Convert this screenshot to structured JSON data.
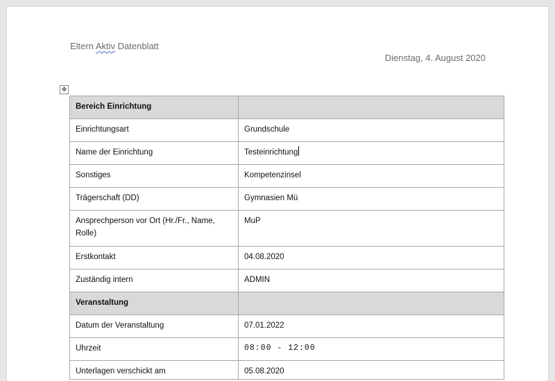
{
  "document": {
    "title_part1": "Eltern ",
    "title_part2": "Aktiv",
    "title_part3": " Datenblatt",
    "date": "Dienstag, 4. August 2020",
    "move_icon": "move-table-icon"
  },
  "table": {
    "section1": {
      "label": "Bereich Einrichtung",
      "value": ""
    },
    "rows1": [
      {
        "label": "Einrichtungsart",
        "value": "Grundschule"
      },
      {
        "label": "Name der Einrichtung",
        "value": "Testeinrichtung"
      },
      {
        "label": "Sonstiges",
        "value": "Kompetenzinsel"
      },
      {
        "label": "Trägerschaft (DD)",
        "value": "Gymnasien Mü"
      },
      {
        "label": "Ansprechperson vor Ort (Hr./Fr., Name, Rolle)",
        "value": "MuP"
      },
      {
        "label": "Erstkontakt",
        "value": "04.08.2020"
      },
      {
        "label": "Zuständig intern",
        "value": "ADMIN"
      }
    ],
    "section2": {
      "label": "Veranstaltung",
      "value": ""
    },
    "rows2": [
      {
        "label": "Datum der Veranstaltung",
        "value": "07.01.2022"
      },
      {
        "label": "Uhrzeit",
        "value": "08:00 - 12:00"
      },
      {
        "label": "Unterlagen verschickt am",
        "value": "05.08.2020"
      }
    ]
  }
}
